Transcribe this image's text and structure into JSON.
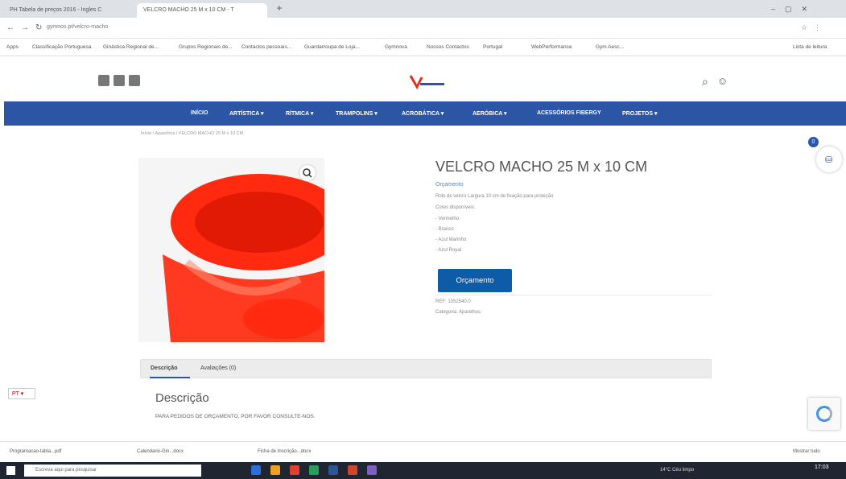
{
  "browser": {
    "tabs": [
      {
        "label": "PH Tabela de preços 2016 - Ingles C"
      },
      {
        "label": "VELCRO MACHO 25 M x 10 CM - T"
      }
    ],
    "new_tab": "+",
    "url": "gymnos.pt/velcro-macho",
    "bookmarks": [
      "Apps",
      "Classificação Portuguesa",
      "Ginástica Regional de...",
      "Grupos Regionais de...",
      "Contactos pessoais...",
      "Guardarroupa de Loja...",
      "Gymnova",
      "Nossos Contactos",
      "Portugal",
      "WebPerformance",
      "Gym Aesc...",
      "Lista de leitura"
    ]
  },
  "site": {
    "logo_text": "gymnos",
    "social_icons": [
      "facebook-icon",
      "instagram-icon",
      "youtube-icon"
    ],
    "nav": [
      "INÍCIO",
      "ARTÍSTICA ▾",
      "RÍTMICA ▾",
      "TRAMPOLINS ▾",
      "ACROBÁTICA ▾",
      "AERÓBICA ▾",
      "ACESSÓRIOS FIBERGY",
      "PROJETOS ▾"
    ],
    "breadcrumb": "Início / Aparelhos / VELCRO MACHO 25 M x 10 CM",
    "cart_count": "0"
  },
  "product": {
    "title": "VELCRO MACHO 25 M x 10 CM",
    "price_label": "Orçamento",
    "description_line": "Rolo de velcro Largura 10 cm de fixação para proteção",
    "colors_label": "Cores disponíveis:",
    "colors": [
      "- Vermelho",
      "- Branco",
      "- Azul Marinho",
      "- Azul Royal"
    ],
    "button": "Orçamento",
    "ref": "REF: 1052540.0",
    "category": "Categoria: Aparelhos"
  },
  "tabs": {
    "items": [
      "Descrição",
      "Avaliações (0)"
    ],
    "active": 0
  },
  "description": {
    "title": "Descrição",
    "text": "PARA PEDIDOS DE ORÇAMENTO, POR FAVOR CONSULTE-NOS."
  },
  "language_flag": "PT ▾",
  "downloads": [
    "Programacao-tabla...pdf",
    "Calendario-Gin...docx",
    "Ficha de Inscrição...docx"
  ],
  "downloads_show_all": "Mostrar tudo",
  "taskbar": {
    "search_placeholder": "Escreva aqui para pesquisar",
    "time": "17:03",
    "weather": "14°C Céu limpo"
  },
  "colors": {
    "nav_bg": "#2c55a5",
    "button_bg": "#0e5ba8",
    "product_red": "#ff2a10"
  }
}
